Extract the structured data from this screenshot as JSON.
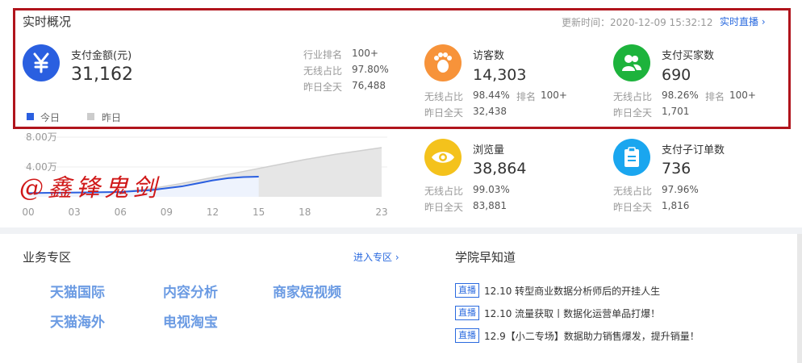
{
  "overview": {
    "title": "实时概况",
    "update_time": "更新时间：2020-12-09 15:32:12",
    "live_link": "实时直播"
  },
  "payment": {
    "label": "支付金额(元)",
    "value": "31,162",
    "icon": "yen-icon",
    "color": "#2a5fe0",
    "stats": [
      {
        "label": "行业排名",
        "value": "100+"
      },
      {
        "label": "无线占比",
        "value": "97.80%"
      },
      {
        "label": "昨日全天",
        "value": "76,488"
      }
    ]
  },
  "legend": {
    "today": "今日",
    "yesterday": "昨日",
    "today_color": "#2a5fe0",
    "yesterday_color": "#cccccc"
  },
  "visitors": {
    "label": "访客数",
    "value": "14,303",
    "icon": "footprint-icon",
    "color": "#f7933a",
    "wireless_label": "无线占比",
    "wireless_value": "98.44%",
    "rank_label": "排名",
    "rank_value": "100+",
    "yesterday_label": "昨日全天",
    "yesterday_value": "32,438"
  },
  "buyers": {
    "label": "支付买家数",
    "value": "690",
    "icon": "users-icon",
    "color": "#1db33c",
    "wireless_label": "无线占比",
    "wireless_value": "98.26%",
    "rank_label": "排名",
    "rank_value": "100+",
    "yesterday_label": "昨日全天",
    "yesterday_value": "1,701"
  },
  "pageviews": {
    "label": "浏览量",
    "value": "38,864",
    "icon": "eye-icon",
    "color": "#f4c21c",
    "wireless_label": "无线占比",
    "wireless_value": "99.03%",
    "yesterday_label": "昨日全天",
    "yesterday_value": "83,881"
  },
  "suborders": {
    "label": "支付子订单数",
    "value": "736",
    "icon": "clipboard-icon",
    "color": "#1aa6ef",
    "wireless_label": "无线占比",
    "wireless_value": "97.96%",
    "yesterday_label": "昨日全天",
    "yesterday_value": "1,816"
  },
  "chart_data": {
    "type": "area",
    "y_ticks": [
      "8.00万",
      "4.00万"
    ],
    "x_ticks": [
      "00",
      "03",
      "06",
      "09",
      "12",
      "15",
      "18",
      "23"
    ],
    "ylim": [
      0,
      80000
    ],
    "series": [
      {
        "name": "今日",
        "x": [
          0,
          2,
          4,
          6,
          8,
          10,
          11,
          12,
          13,
          14,
          15
        ],
        "values": [
          5000,
          5500,
          6000,
          6500,
          9000,
          14000,
          18000,
          22000,
          25000,
          26500,
          27000
        ],
        "color": "#2a5fe0"
      },
      {
        "name": "昨日",
        "x": [
          0,
          2,
          4,
          6,
          8,
          10,
          12,
          14,
          16,
          18,
          20,
          22,
          23
        ],
        "values": [
          5000,
          5500,
          6000,
          7000,
          11000,
          18000,
          26000,
          34000,
          42000,
          50000,
          57000,
          63000,
          66000
        ],
        "color": "#cccccc"
      }
    ]
  },
  "watermark": "@鑫锋鬼剑",
  "business": {
    "title": "业务专区",
    "enter_link": "进入专区",
    "items": [
      "天猫国际",
      "内容分析",
      "商家短视频",
      "天猫海外",
      "电视淘宝"
    ]
  },
  "academy": {
    "title": "学院早知道",
    "badge": "直播",
    "news": [
      "12.10 转型商业数据分析师后的开挂人生",
      "12.10 流量获取丨数据化运营单品打爆！",
      "12.9【小二专场】数据助力销售爆发，提升销量！"
    ]
  }
}
